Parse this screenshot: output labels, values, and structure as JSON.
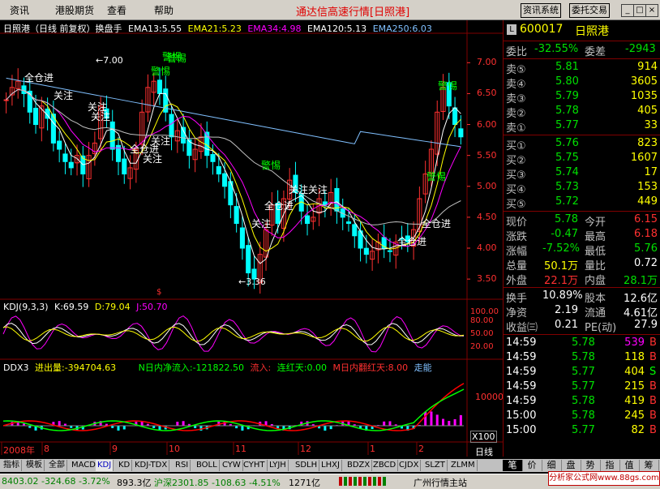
{
  "menu": {
    "items": [
      "资讯",
      "港股期货",
      "查看",
      "帮助"
    ],
    "title": "通达信高速行情[日照港]",
    "buttons": [
      "资讯系统",
      "委托交易"
    ],
    "win_buttons": [
      "_",
      "□",
      "×"
    ]
  },
  "chart": {
    "header_name": "日照港（日线 前复权）换盘手",
    "ema": [
      {
        "label": "EMA13:5.55",
        "color": "#ffffff"
      },
      {
        "label": "EMA21:5.23",
        "color": "#ffff00"
      },
      {
        "label": "EMA34:4.98",
        "color": "#ff00ff"
      },
      {
        "label": "EMA120:5.13",
        "color": "#ffffff"
      },
      {
        "label": "EMA250:6.03",
        "color": "#80c0ff"
      }
    ],
    "price_ticks": [
      "7.00",
      "6.50",
      "6.00",
      "5.50",
      "5.00",
      "4.50",
      "4.00",
      "3.50"
    ],
    "high_label": "7.00",
    "low_label": "3.36",
    "kdj_header": {
      "name": "KDJ(9,3,3)",
      "k": "K:69.59",
      "d": "D:79.04",
      "j": "J:50.70"
    },
    "kdj_ticks": [
      "100.00",
      "80.00",
      "50.00",
      "20.00"
    ],
    "ddx_header": {
      "name": "DDX3",
      "inflow": "进出量:-394704.63",
      "net": "N日内净流入:-121822.50",
      "flow": "流入:",
      "red_days": "连红天:0.00",
      "red_m": "M日内翻红天:8.00",
      "trend": "走能"
    },
    "ddx_ticks": [
      "10000"
    ],
    "ddx_unit": "X100",
    "x_labels": [
      "2008年",
      "8",
      "9",
      "10",
      "11",
      "12",
      "1",
      "2"
    ],
    "period": "日线",
    "annotations": [
      "警惕",
      "警惕",
      "全仓进",
      "关注",
      "关注",
      "关注",
      "关注",
      "全仓进",
      "关注",
      "警惕",
      "全仓进",
      "关注",
      "关注",
      "全仓进",
      "警惕",
      "警惕",
      "全仓进",
      "关注",
      "警惕"
    ]
  },
  "quote": {
    "code": "600017",
    "name": "日照港",
    "wei_bi": {
      "label": "委比",
      "value": "-32.55%"
    },
    "wei_cha": {
      "label": "委差",
      "value": "-2943"
    },
    "sell": [
      {
        "label": "卖⑤",
        "price": "5.81",
        "vol": "914"
      },
      {
        "label": "卖④",
        "price": "5.80",
        "vol": "3605"
      },
      {
        "label": "卖③",
        "price": "5.79",
        "vol": "1035"
      },
      {
        "label": "卖②",
        "price": "5.78",
        "vol": "405"
      },
      {
        "label": "卖①",
        "price": "5.77",
        "vol": "33"
      }
    ],
    "buy": [
      {
        "label": "买①",
        "price": "5.76",
        "vol": "823"
      },
      {
        "label": "买②",
        "price": "5.75",
        "vol": "1607"
      },
      {
        "label": "买③",
        "price": "5.74",
        "vol": "17"
      },
      {
        "label": "买④",
        "price": "5.73",
        "vol": "153"
      },
      {
        "label": "买⑤",
        "price": "5.72",
        "vol": "449"
      }
    ],
    "stats": [
      {
        "l1": "现价",
        "v1": "5.78",
        "c1": "green",
        "l2": "今开",
        "v2": "6.15",
        "c2": "red"
      },
      {
        "l1": "涨跌",
        "v1": "-0.47",
        "c1": "green",
        "l2": "最高",
        "v2": "6.18",
        "c2": "red"
      },
      {
        "l1": "涨幅",
        "v1": "-7.52%",
        "c1": "green",
        "l2": "最低",
        "v2": "5.76",
        "c2": "green"
      },
      {
        "l1": "总量",
        "v1": "50.1万",
        "c1": "yel",
        "l2": "量比",
        "v2": "0.72",
        "c2": "wht"
      },
      {
        "l1": "外盘",
        "v1": "22.1万",
        "c1": "red",
        "l2": "内盘",
        "v2": "28.1万",
        "c2": "green"
      }
    ],
    "fund": [
      {
        "l1": "换手",
        "v1": "10.89%",
        "l2": "股本",
        "v2": "12.6亿"
      },
      {
        "l1": "净资",
        "v1": "2.19",
        "l2": "流通",
        "v2": "4.61亿"
      },
      {
        "l1": "收益㈢",
        "v1": "0.21",
        "l2": "PE(动)",
        "v2": "27.9"
      }
    ],
    "ticks": [
      {
        "time": "14:59",
        "price": "5.78",
        "vol": "539",
        "side": "B"
      },
      {
        "time": "14:59",
        "price": "5.78",
        "vol": "118",
        "side": "B"
      },
      {
        "time": "14:59",
        "price": "5.77",
        "vol": "404",
        "side": "S"
      },
      {
        "time": "14:59",
        "price": "5.77",
        "vol": "215",
        "side": "B"
      },
      {
        "time": "14:59",
        "price": "5.78",
        "vol": "419",
        "side": "B"
      },
      {
        "time": "15:00",
        "price": "5.78",
        "vol": "245",
        "side": "B"
      },
      {
        "time": "15:00",
        "price": "5.77",
        "vol": "82",
        "side": "B"
      }
    ]
  },
  "tabs": [
    "指标",
    "模板",
    "全部",
    "MACD",
    "KDJ",
    "KD",
    "KDJ-TDX",
    "RSI",
    "BOLL",
    "CYW",
    "CYHT",
    "LYJH",
    "SDLH",
    "LHXJ",
    "BDZX",
    "ZBCD",
    "CJDX",
    "SLZT",
    "ZLMM"
  ],
  "right_tabs": [
    "笔",
    "价",
    "细",
    "盘",
    "势",
    "指",
    "值",
    "筹"
  ],
  "status": {
    "sh": "8403.02 -324.68 -3.72%",
    "sh_amt": "893.3亿",
    "sz": "沪深2301.85 -108.63 -4.51%",
    "sz_amt": "1271亿",
    "station": "广州行情主站"
  },
  "site_badge": "分析家公式网www.88gs.com",
  "colors": {
    "up": "#ff3030",
    "down": "#00ffff",
    "bg": "#000000",
    "grid": "#800000"
  }
}
